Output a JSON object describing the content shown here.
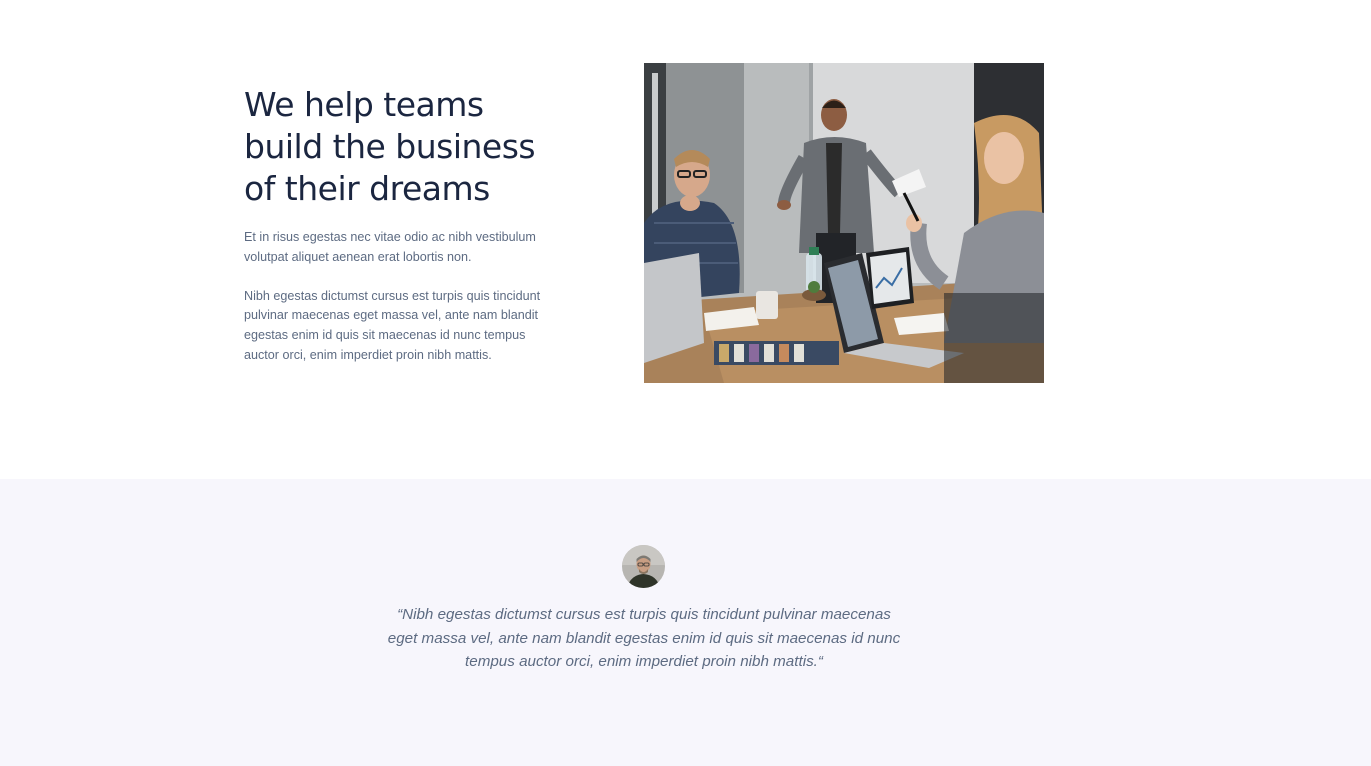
{
  "hero": {
    "title_lines": [
      "We help teams",
      "build the business",
      "of their dreams"
    ],
    "paragraph_1": "Et in risus egestas nec vitae odio ac nibh vestibulum volutpat aliquet aenean erat lobortis non.",
    "paragraph_2": "Nibh egestas dictumst cursus est turpis quis tincidunt pulvinar maecenas eget massa vel, ante nam blandit egestas enim id quis sit maecenas id nunc tempus auctor orci, enim imperdiet proin nibh mattis.",
    "image_subject": "team-meeting-photo"
  },
  "testimonial": {
    "avatar": "person-avatar",
    "quote_lines": [
      "“Nibh egestas dictumst cursus est turpis quis tincidunt pulvinar maecenas",
      "eget massa vel, ante nam blandit egestas enim id quis sit maecenas id nunc",
      "tempus auctor orci, enim imperdiet proin nibh mattis.“"
    ]
  },
  "colors": {
    "heading": "#1b2640",
    "body_text": "#5d6b82",
    "testimonial_background": "#f7f6fc",
    "page_background": "#ffffff"
  }
}
